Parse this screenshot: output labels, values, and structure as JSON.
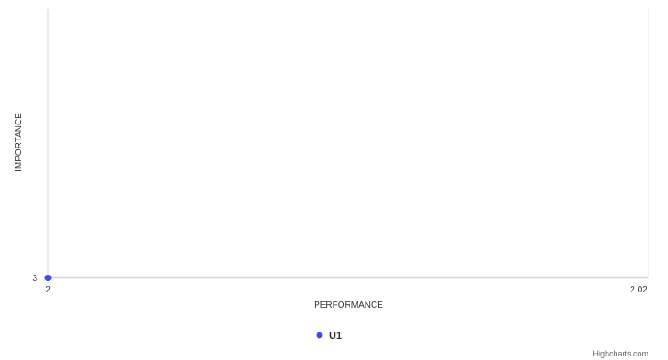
{
  "chart_data": {
    "type": "scatter",
    "xlabel": "PERFORMANCE",
    "ylabel": "IMPORTANCE",
    "x_ticks": [
      "2",
      "2.02"
    ],
    "y_ticks": [
      "3"
    ],
    "xlim": [
      2,
      2.02
    ],
    "ylim": [
      3,
      3
    ],
    "grid": false,
    "legend_position": "bottom-center",
    "series": [
      {
        "name": "U1",
        "color": "#3d4de8",
        "points": [
          {
            "x": 2,
            "y": 3
          }
        ]
      }
    ]
  },
  "credits": "Highcharts.com",
  "colors": {
    "axis_line": "#ccd6eb",
    "plot_line": "#e6e6e6"
  }
}
